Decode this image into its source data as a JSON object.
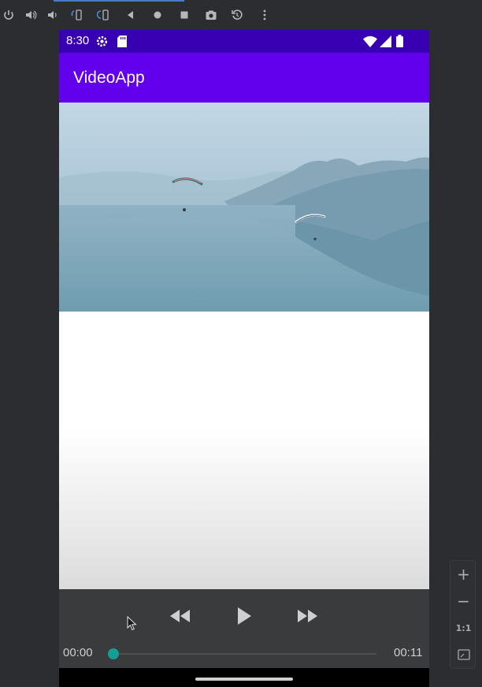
{
  "emulator_toolbar": {
    "icons": [
      "power-icon",
      "volume-up-icon",
      "volume-down-icon",
      "rotate-left-icon",
      "rotate-right-icon",
      "back-icon",
      "home-icon",
      "overview-icon",
      "screenshot-icon",
      "snapshot-icon",
      "more-icon"
    ]
  },
  "status_bar": {
    "time": "8:30",
    "icons": [
      "settings-icon",
      "sd-card-icon",
      "wifi-icon",
      "signal-icon",
      "battery-icon"
    ]
  },
  "app_bar": {
    "title": "VideoApp"
  },
  "media_controller": {
    "current_time": "00:00",
    "duration": "00:11",
    "progress": 0.0,
    "buttons": [
      "rewind-icon",
      "play-icon",
      "fast-forward-icon"
    ]
  },
  "zoom_controls": {
    "zoom_in": "+",
    "zoom_out": "−",
    "actual_size": "1:1"
  },
  "colors": {
    "status_bar": "#3700b3",
    "app_bar": "#6200ee",
    "seek_thumb": "#139e96",
    "controller_bg": "#3a3b3c"
  }
}
